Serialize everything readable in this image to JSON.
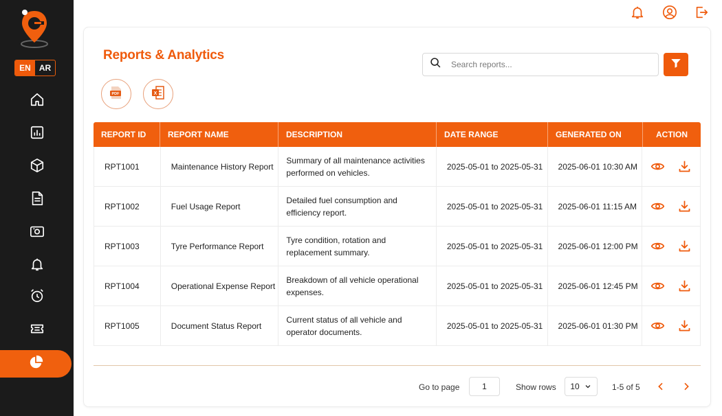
{
  "language": {
    "en": "EN",
    "ar": "AR",
    "selected": "EN"
  },
  "sidebar": {
    "items": [
      {
        "icon": "home-icon"
      },
      {
        "icon": "dashboard-chart-icon"
      },
      {
        "icon": "box-icon"
      },
      {
        "icon": "document-icon"
      },
      {
        "icon": "camera-icon"
      },
      {
        "icon": "bell-icon"
      },
      {
        "icon": "alarm-clock-icon"
      },
      {
        "icon": "ticket-icon"
      },
      {
        "icon": "pie-chart-icon",
        "active": true
      }
    ]
  },
  "topbar": {
    "icons": [
      "bell-icon",
      "user-icon",
      "logout-icon"
    ]
  },
  "page": {
    "title": "Reports & Analytics"
  },
  "search": {
    "placeholder": "Search reports..."
  },
  "exports": [
    {
      "label": "PDF",
      "icon": "pdf-icon"
    },
    {
      "label": "X",
      "icon": "excel-icon"
    }
  ],
  "table": {
    "headers": [
      "REPORT ID",
      "REPORT NAME",
      "DESCRIPTION",
      "DATE RANGE",
      "GENERATED ON",
      "ACTION"
    ],
    "rows": [
      {
        "id": "RPT1001",
        "name": "Maintenance History Report",
        "desc": "Summary of all maintenance activities performed on vehicles.",
        "range": "2025-05-01 to 2025-05-31",
        "generated": "2025-06-01 10:30 AM"
      },
      {
        "id": "RPT1002",
        "name": "Fuel Usage Report",
        "desc": "Detailed fuel consumption and efficiency report.",
        "range": "2025-05-01 to 2025-05-31",
        "generated": "2025-06-01 11:15 AM"
      },
      {
        "id": "RPT1003",
        "name": "Tyre Performance Report",
        "desc": "Tyre condition, rotation and replacement summary.",
        "range": "2025-05-01 to 2025-05-31",
        "generated": "2025-06-01 12:00 PM"
      },
      {
        "id": "RPT1004",
        "name": "Operational Expense Report",
        "desc": "Breakdown of all vehicle operational expenses.",
        "range": "2025-05-01 to 2025-05-31",
        "generated": "2025-06-01 12:45 PM"
      },
      {
        "id": "RPT1005",
        "name": "Document Status Report",
        "desc": "Current status of all vehicle and operator documents.",
        "range": "2025-05-01 to 2025-05-31",
        "generated": "2025-06-01 01:30 PM"
      }
    ]
  },
  "pagination": {
    "goto_label": "Go to page",
    "page": "1",
    "rows_label": "Show rows",
    "rows": "10",
    "summary": "1-5 of 5"
  },
  "colors": {
    "accent": "#ef5a0b",
    "sidebar": "#1b1b1b"
  }
}
